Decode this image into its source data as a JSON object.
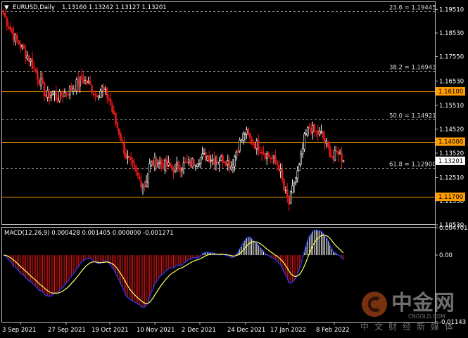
{
  "header": {
    "symbol_tf": "EURUSD,Daily",
    "ohlc": "1.13160 1.13242 1.13127 1.13201"
  },
  "macd_header": "MACD(12,26,9) 0.000428 0.001405 0.000000 -0.001271",
  "watermark": {
    "brand": "中金网",
    "site": "CNGOLD.COM",
    "tagline": "中文财经新媒体"
  },
  "chart_data": {
    "type": "candlestick",
    "ylim": [
      1.1053,
      1.1982
    ],
    "price_ticks": [
      "1.19510",
      "1.18530",
      "1.17550",
      "1.16530",
      "1.15510",
      "1.14520",
      "1.13520",
      "1.12510",
      "1.11530",
      "1.10530"
    ],
    "x_labels": [
      "3 Sep 2021",
      "27 Sep 2021",
      "19 Oct 2021",
      "10 Nov 2021",
      "2 Dec 2021",
      "24 Dec 2021",
      "17 Jan 2022",
      "8 Feb 2022"
    ],
    "current_price": "1.13201",
    "horizontal_levels": [
      {
        "value": 1.161,
        "label": "1.16100"
      },
      {
        "value": 1.14,
        "label": "1.14000"
      },
      {
        "value": 1.117,
        "label": "1.11700"
      }
    ],
    "fibonacci": [
      {
        "value": 1.19445,
        "label": "23.6 = 1.19445"
      },
      {
        "value": 1.16943,
        "label": "38.2 = 1.16943"
      },
      {
        "value": 1.14921,
        "label": "50.0 = 1.14921"
      },
      {
        "value": 1.129,
        "label": "61.8 = 1.12900"
      }
    ],
    "candles": [],
    "macd": {
      "ylim": [
        -0.01143,
        0.004701
      ],
      "ticks": [
        "0.004701",
        "0.00",
        "-0.01143"
      ],
      "histogram": [],
      "macd_line": [],
      "signal_line": []
    }
  },
  "colors": {
    "background": "#000000",
    "bull": "#ffffff",
    "bear": "#e01818",
    "level": "#ff9c00",
    "fib": "#9a9a9a",
    "macd_line": "#1e3cff",
    "signal_line": "#ffff66",
    "axis": "#ffffff"
  }
}
